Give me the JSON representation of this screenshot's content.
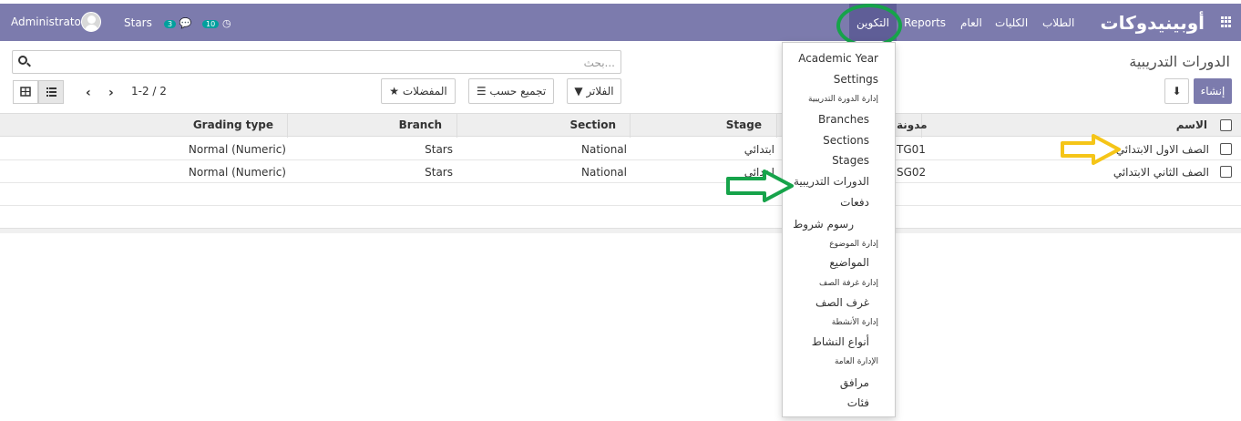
{
  "navbar": {
    "brand": "أوبينيدوكات",
    "menus": [
      "الطلاب",
      "الكليات",
      "العام",
      "Reports"
    ],
    "active_menu": "التكوين",
    "user": "Administrator",
    "company": "Stars",
    "messages_count": "3",
    "activities_count": "10"
  },
  "control_panel": {
    "breadcrumb": "الدورات التدريبية",
    "search_placeholder": "بحث...",
    "create_label": "إنشاء",
    "filters_label": "الفلاتر",
    "groupby_label": "تجميع حسب",
    "favorites_label": "المفضلات",
    "pager": "1-2 / 2"
  },
  "table": {
    "headers": {
      "name": "الاسم",
      "code": "مدونة",
      "stage": "Stage",
      "section": "Section",
      "branch": "Branch",
      "grading": "Grading type"
    },
    "rows": [
      {
        "name": "الصف الاول الابتدائي",
        "code": "TG01",
        "stage": "ابتدائي",
        "section": "National",
        "branch": "Stars",
        "grading": "Normal (Numeric)"
      },
      {
        "name": "الصف الثاني الابتدائي",
        "code": "SG02",
        "stage": "ابتدائي",
        "section": "National",
        "branch": "Stars",
        "grading": "Normal (Numeric)"
      }
    ]
  },
  "dropdown": {
    "items": [
      {
        "label": "Academic Year",
        "kind": "item"
      },
      {
        "label": "Settings",
        "kind": "item"
      },
      {
        "label": "إدارة الدورة التدريبية",
        "kind": "header"
      },
      {
        "label": "Branches",
        "kind": "item"
      },
      {
        "label": "Sections",
        "kind": "item"
      },
      {
        "label": "Stages",
        "kind": "item"
      },
      {
        "label": "الدورات التدريبية",
        "kind": "item"
      },
      {
        "label": "دفعات",
        "kind": "item"
      },
      {
        "label": "رسوم شروط",
        "kind": "item"
      },
      {
        "label": "إدارة الموضوع",
        "kind": "header"
      },
      {
        "label": "المواضيع",
        "kind": "item"
      },
      {
        "label": "إدارة غرفة الصف",
        "kind": "header"
      },
      {
        "label": "غرف الصف",
        "kind": "item"
      },
      {
        "label": "إدارة الأنشطة",
        "kind": "header"
      },
      {
        "label": "أنواع النشاط",
        "kind": "item"
      },
      {
        "label": "الإدارة العامة",
        "kind": "header"
      },
      {
        "label": "مرافق",
        "kind": "item"
      },
      {
        "label": "فئات",
        "kind": "item"
      }
    ]
  },
  "colors": {
    "navbar": "#7c7bad",
    "active_menu": "#5f5e97",
    "badge": "#00a09d",
    "annotation_green": "#16a34a",
    "annotation_yellow": "#f5c518"
  }
}
